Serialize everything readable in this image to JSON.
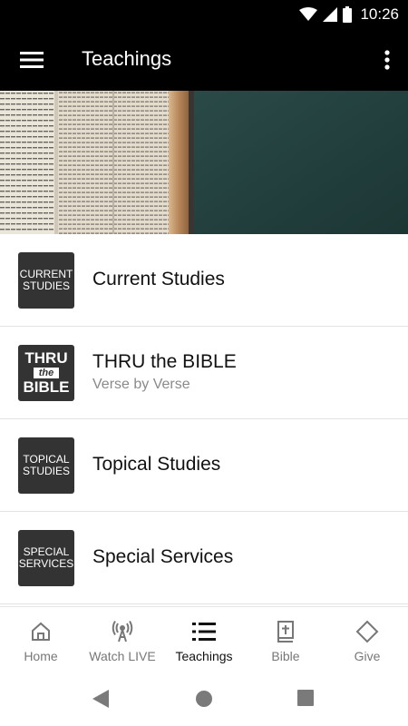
{
  "status": {
    "time": "10:26"
  },
  "appbar": {
    "title": "Teachings"
  },
  "list": {
    "items": [
      {
        "thumb_line1": "CURRENT",
        "thumb_line2": "STUDIES",
        "title": "Current Studies",
        "subtitle": ""
      },
      {
        "thumb_line1": "THRU",
        "thumb_line2": "BIBLE",
        "thumb_mid": "the",
        "title": "THRU the BIBLE",
        "subtitle": "Verse by Verse"
      },
      {
        "thumb_line1": "TOPICAL",
        "thumb_line2": "STUDIES",
        "title": "Topical Studies",
        "subtitle": ""
      },
      {
        "thumb_line1": "SPECIAL",
        "thumb_line2": "SERVICES",
        "title": "Special Services",
        "subtitle": ""
      }
    ]
  },
  "nav": {
    "items": [
      {
        "label": "Home",
        "icon": "home-icon"
      },
      {
        "label": "Watch LIVE",
        "icon": "broadcast-icon"
      },
      {
        "label": "Teachings",
        "icon": "list-icon"
      },
      {
        "label": "Bible",
        "icon": "bible-icon"
      },
      {
        "label": "Give",
        "icon": "diamond-icon"
      }
    ],
    "active": "Teachings"
  },
  "colors": {
    "appbar": "#000000",
    "thumb": "#333333",
    "banner_page": "#e9e4d8",
    "banner_cover": "#22403f"
  }
}
